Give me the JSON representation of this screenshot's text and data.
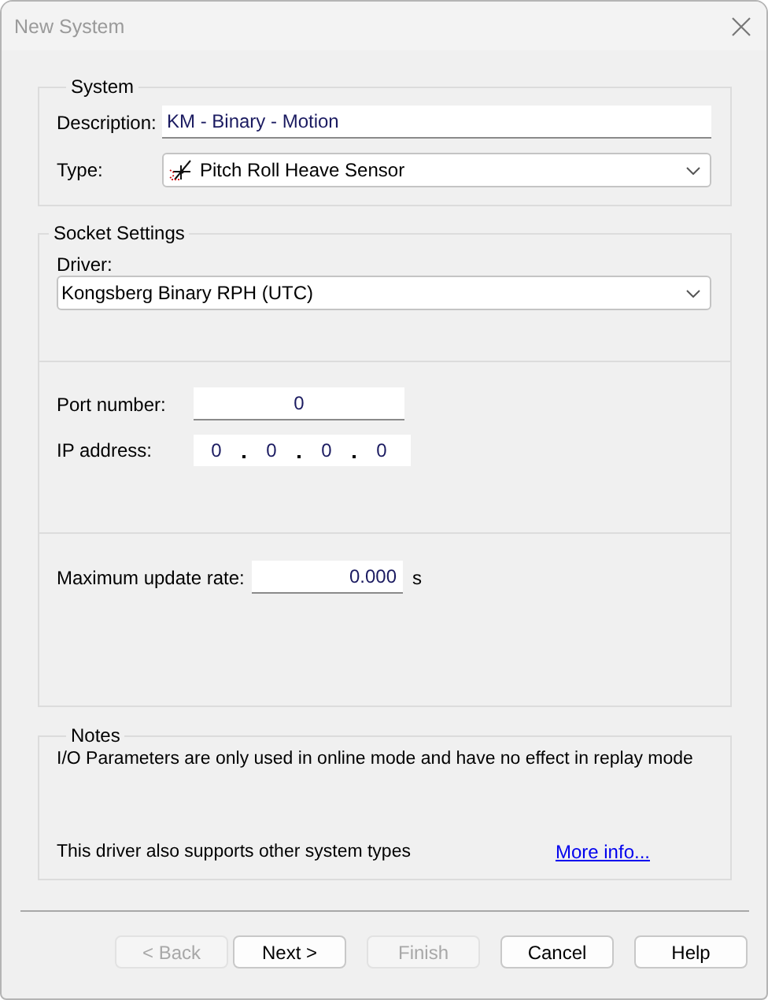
{
  "window": {
    "title": "New System"
  },
  "system": {
    "legend": "System",
    "description": {
      "label": "Description:",
      "value": "KM - Binary - Motion"
    },
    "type": {
      "label": "Type:",
      "value": "Pitch Roll Heave Sensor"
    }
  },
  "socket_settings": {
    "legend": "Socket Settings",
    "driver": {
      "label": "Driver:",
      "value": "Kongsberg Binary RPH (UTC)"
    },
    "port_number": {
      "label": "Port number:",
      "value": "0"
    },
    "ip_address": {
      "label": "IP address:",
      "octets": [
        "0",
        "0",
        "0",
        "0"
      ]
    },
    "max_update_rate": {
      "label": "Maximum update rate:",
      "value": "0.000",
      "unit": "s"
    }
  },
  "notes": {
    "legend": "Notes",
    "text": "I/O Parameters are only used in online mode and have no effect in replay mode",
    "supports_text": "This driver also supports other system types",
    "link": "More info..."
  },
  "buttons": [
    {
      "label": "< Back",
      "disabled": true
    },
    {
      "label": "Next >",
      "disabled": false
    },
    {
      "label": "Finish",
      "disabled": true
    },
    {
      "label": "Cancel",
      "disabled": false
    },
    {
      "label": "Help",
      "disabled": false
    }
  ]
}
